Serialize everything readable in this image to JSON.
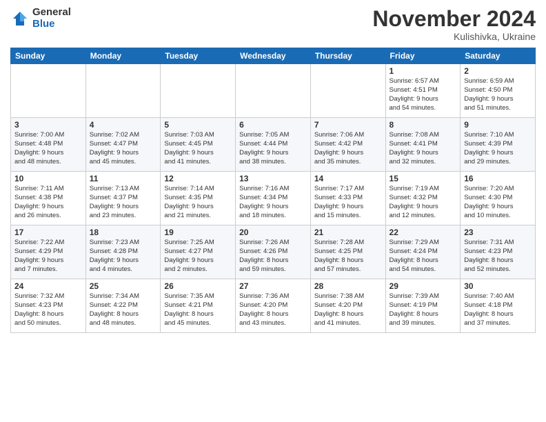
{
  "logo": {
    "general": "General",
    "blue": "Blue"
  },
  "title": "November 2024",
  "location": "Kulishivka, Ukraine",
  "days_of_week": [
    "Sunday",
    "Monday",
    "Tuesday",
    "Wednesday",
    "Thursday",
    "Friday",
    "Saturday"
  ],
  "weeks": [
    [
      {
        "day": "",
        "info": ""
      },
      {
        "day": "",
        "info": ""
      },
      {
        "day": "",
        "info": ""
      },
      {
        "day": "",
        "info": ""
      },
      {
        "day": "",
        "info": ""
      },
      {
        "day": "1",
        "info": "Sunrise: 6:57 AM\nSunset: 4:51 PM\nDaylight: 9 hours\nand 54 minutes."
      },
      {
        "day": "2",
        "info": "Sunrise: 6:59 AM\nSunset: 4:50 PM\nDaylight: 9 hours\nand 51 minutes."
      }
    ],
    [
      {
        "day": "3",
        "info": "Sunrise: 7:00 AM\nSunset: 4:48 PM\nDaylight: 9 hours\nand 48 minutes."
      },
      {
        "day": "4",
        "info": "Sunrise: 7:02 AM\nSunset: 4:47 PM\nDaylight: 9 hours\nand 45 minutes."
      },
      {
        "day": "5",
        "info": "Sunrise: 7:03 AM\nSunset: 4:45 PM\nDaylight: 9 hours\nand 41 minutes."
      },
      {
        "day": "6",
        "info": "Sunrise: 7:05 AM\nSunset: 4:44 PM\nDaylight: 9 hours\nand 38 minutes."
      },
      {
        "day": "7",
        "info": "Sunrise: 7:06 AM\nSunset: 4:42 PM\nDaylight: 9 hours\nand 35 minutes."
      },
      {
        "day": "8",
        "info": "Sunrise: 7:08 AM\nSunset: 4:41 PM\nDaylight: 9 hours\nand 32 minutes."
      },
      {
        "day": "9",
        "info": "Sunrise: 7:10 AM\nSunset: 4:39 PM\nDaylight: 9 hours\nand 29 minutes."
      }
    ],
    [
      {
        "day": "10",
        "info": "Sunrise: 7:11 AM\nSunset: 4:38 PM\nDaylight: 9 hours\nand 26 minutes."
      },
      {
        "day": "11",
        "info": "Sunrise: 7:13 AM\nSunset: 4:37 PM\nDaylight: 9 hours\nand 23 minutes."
      },
      {
        "day": "12",
        "info": "Sunrise: 7:14 AM\nSunset: 4:35 PM\nDaylight: 9 hours\nand 21 minutes."
      },
      {
        "day": "13",
        "info": "Sunrise: 7:16 AM\nSunset: 4:34 PM\nDaylight: 9 hours\nand 18 minutes."
      },
      {
        "day": "14",
        "info": "Sunrise: 7:17 AM\nSunset: 4:33 PM\nDaylight: 9 hours\nand 15 minutes."
      },
      {
        "day": "15",
        "info": "Sunrise: 7:19 AM\nSunset: 4:32 PM\nDaylight: 9 hours\nand 12 minutes."
      },
      {
        "day": "16",
        "info": "Sunrise: 7:20 AM\nSunset: 4:30 PM\nDaylight: 9 hours\nand 10 minutes."
      }
    ],
    [
      {
        "day": "17",
        "info": "Sunrise: 7:22 AM\nSunset: 4:29 PM\nDaylight: 9 hours\nand 7 minutes."
      },
      {
        "day": "18",
        "info": "Sunrise: 7:23 AM\nSunset: 4:28 PM\nDaylight: 9 hours\nand 4 minutes."
      },
      {
        "day": "19",
        "info": "Sunrise: 7:25 AM\nSunset: 4:27 PM\nDaylight: 9 hours\nand 2 minutes."
      },
      {
        "day": "20",
        "info": "Sunrise: 7:26 AM\nSunset: 4:26 PM\nDaylight: 8 hours\nand 59 minutes."
      },
      {
        "day": "21",
        "info": "Sunrise: 7:28 AM\nSunset: 4:25 PM\nDaylight: 8 hours\nand 57 minutes."
      },
      {
        "day": "22",
        "info": "Sunrise: 7:29 AM\nSunset: 4:24 PM\nDaylight: 8 hours\nand 54 minutes."
      },
      {
        "day": "23",
        "info": "Sunrise: 7:31 AM\nSunset: 4:23 PM\nDaylight: 8 hours\nand 52 minutes."
      }
    ],
    [
      {
        "day": "24",
        "info": "Sunrise: 7:32 AM\nSunset: 4:23 PM\nDaylight: 8 hours\nand 50 minutes."
      },
      {
        "day": "25",
        "info": "Sunrise: 7:34 AM\nSunset: 4:22 PM\nDaylight: 8 hours\nand 48 minutes."
      },
      {
        "day": "26",
        "info": "Sunrise: 7:35 AM\nSunset: 4:21 PM\nDaylight: 8 hours\nand 45 minutes."
      },
      {
        "day": "27",
        "info": "Sunrise: 7:36 AM\nSunset: 4:20 PM\nDaylight: 8 hours\nand 43 minutes."
      },
      {
        "day": "28",
        "info": "Sunrise: 7:38 AM\nSunset: 4:20 PM\nDaylight: 8 hours\nand 41 minutes."
      },
      {
        "day": "29",
        "info": "Sunrise: 7:39 AM\nSunset: 4:19 PM\nDaylight: 8 hours\nand 39 minutes."
      },
      {
        "day": "30",
        "info": "Sunrise: 7:40 AM\nSunset: 4:18 PM\nDaylight: 8 hours\nand 37 minutes."
      }
    ]
  ]
}
